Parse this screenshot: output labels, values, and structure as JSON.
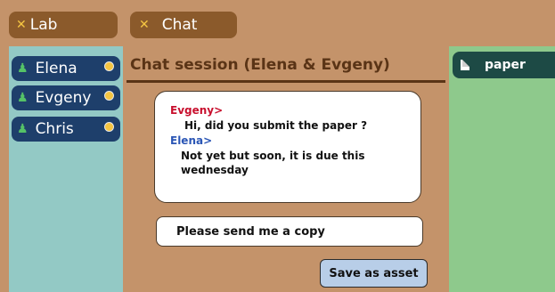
{
  "tabs": {
    "lab": {
      "icon": "tools-icon",
      "label": "Lab"
    },
    "chat": {
      "icon": "tools-icon",
      "label": "Chat"
    }
  },
  "users": [
    {
      "name": "Elena",
      "status_color": "#f5c542"
    },
    {
      "name": "Evgeny",
      "status_color": "#f5c542"
    },
    {
      "name": "Chris",
      "status_color": "#f5c542"
    }
  ],
  "chat": {
    "title": "Chat session (Elena & Evgeny)",
    "messages": [
      {
        "sender": "Evgeny>",
        "lines": [
          "Hi, did you submit the paper ?"
        ]
      },
      {
        "sender": "Elena>",
        "lines": [
          "Not yet but soon, it is due this",
          "wednesday"
        ]
      }
    ],
    "input_value": "Please send me a copy",
    "save_label": "Save as asset"
  },
  "assets": [
    {
      "icon": "document-icon",
      "label": "paper"
    }
  ],
  "colors": {
    "background": "#c4936a",
    "tab": "#8b5a2b",
    "user_chip": "#1e3f6b",
    "users_panel": "#93c9c5",
    "assets_panel": "#8ec98c",
    "asset_chip": "#1d4a45",
    "evgeny": "#c8102e",
    "elena": "#2b56b5",
    "save_button": "#b8cee8"
  }
}
